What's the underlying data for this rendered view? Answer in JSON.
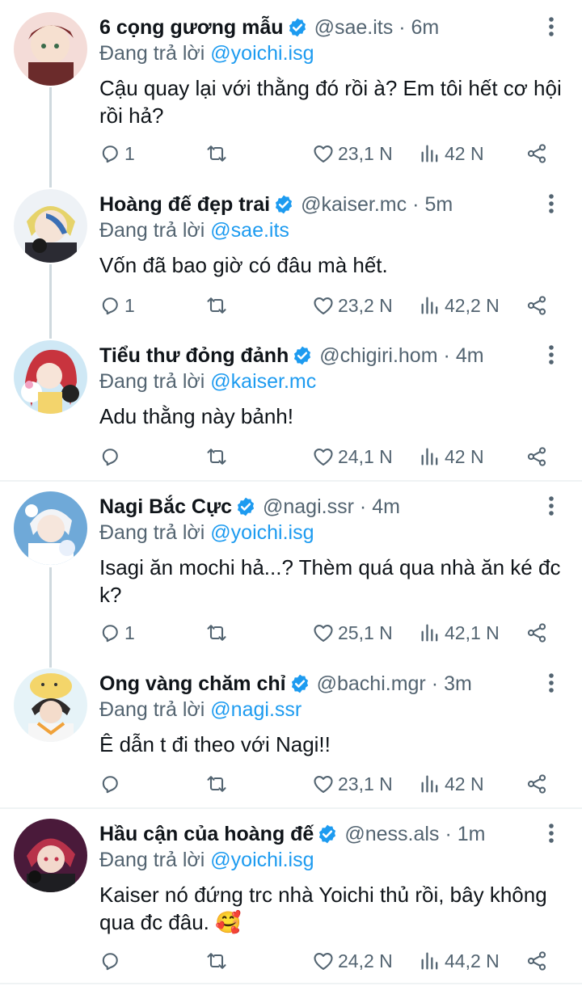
{
  "colors": {
    "accent": "#1d9bf0",
    "secondary_text": "#536471",
    "primary_text": "#0f1419"
  },
  "reply_prefix": "Đang trả lời",
  "tweets": [
    {
      "name": "6 cọng gương mẫu",
      "handle": "@sae.its",
      "time": "6m",
      "reply_to": "@yoichi.isg",
      "text": "Cậu quay lại với thằng đó rồi à? Em tôi hết cơ hội rồi hả?",
      "replies": "1",
      "likes": "23,1 N",
      "views": "42 N"
    },
    {
      "name": "Hoàng đế đẹp trai",
      "handle": "@kaiser.mc",
      "time": "5m",
      "reply_to": "@sae.its",
      "text": "Vốn đã bao giờ có đâu mà hết.",
      "replies": "1",
      "likes": "23,2 N",
      "views": "42,2 N"
    },
    {
      "name": "Tiểu thư đỏng đảnh",
      "handle": "@chigiri.hom",
      "time": "4m",
      "reply_to": "@kaiser.mc",
      "text": "Adu thằng này bảnh!",
      "replies": "",
      "likes": "24,1 N",
      "views": "42 N"
    },
    {
      "name": "Nagi Bắc Cực",
      "handle": "@nagi.ssr",
      "time": "4m",
      "reply_to": "@yoichi.isg",
      "text": "Isagi ăn mochi hả...? Thèm quá qua nhà ăn ké đc k?",
      "replies": "1",
      "likes": "25,1 N",
      "views": "42,1 N"
    },
    {
      "name": "Ong vàng chăm chỉ",
      "handle": "@bachi.mgr",
      "time": "3m",
      "reply_to": "@nagi.ssr",
      "text": "Ê dẫn t đi theo với Nagi!!",
      "replies": "",
      "likes": "23,1 N",
      "views": "42 N"
    },
    {
      "name": "Hầu cận của hoàng đế",
      "handle": "@ness.als",
      "time": "1m",
      "reply_to": "@yoichi.isg",
      "text": "Kaiser nó đứng trc nhà Yoichi thủ rồi, bây không qua đc đâu. 🥰",
      "replies": "",
      "likes": "24,2 N",
      "views": "44,2 N"
    }
  ]
}
